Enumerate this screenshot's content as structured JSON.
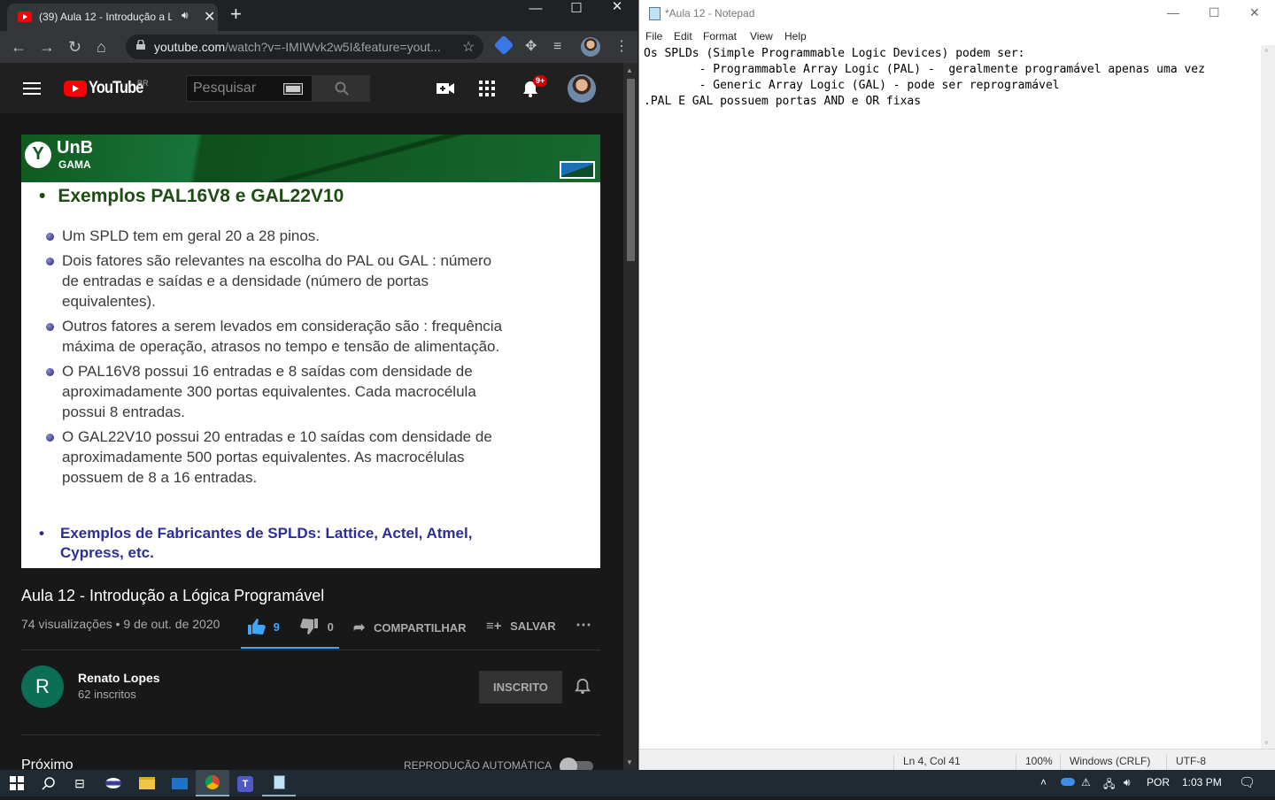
{
  "chrome": {
    "tab_title": "(39) Aula 12 - Introdução a Lógica Programável",
    "url_domain": "youtube.com",
    "url_rest": "/watch?v=-IMIWvk2w5I&feature=yout...",
    "window_min": "—",
    "window_max": "☐",
    "window_close": "✕"
  },
  "youtube": {
    "logo_text": "YouTube",
    "region": "BR",
    "search_placeholder": "Pesquisar",
    "notif_badge": "9+",
    "video_title": "Aula 12 - Introdução a Lógica Programável",
    "views_date": "74 visualizações • 9 de out. de 2020",
    "likes": "9",
    "dislikes": "0",
    "share": "COMPARTILHAR",
    "save": "SALVAR",
    "channel_initial": "R",
    "channel_name": "Renato Lopes",
    "channel_subs": "62 inscritos",
    "subscribed": "INSCRITO",
    "next_label": "Próximo",
    "autoplay_label": "REPRODUÇÃO AUTOMÁTICA"
  },
  "slide": {
    "logo": "UnB",
    "logo_sub": "GAMA",
    "heading": "Exemplos PAL16V8 e GAL22V10",
    "bullets": [
      "Um SPLD tem em geral 20 a 28 pinos.",
      "Dois fatores são relevantes na escolha do PAL ou GAL : número de entradas e saídas e a densidade (número de portas equivalentes).",
      "Outros fatores a serem levados em consideração são : frequência máxima de operação, atrasos no tempo e tensão de alimentação.",
      "O PAL16V8 possui 16 entradas e 8 saídas com densidade de aproximadamente 300 portas equivalentes. Cada macrocélula possui 8 entradas.",
      "O GAL22V10 possui 20 entradas e 10 saídas com densidade de aproximadamente 500 portas equivalentes. As macrocélulas possuem de 8 a 16 entradas."
    ],
    "manufacturers": "Exemplos de Fabricantes de SPLDs: Lattice, Actel, Atmel, Cypress, etc."
  },
  "notepad": {
    "title": "*Aula 12 - Notepad",
    "menu": [
      "File",
      "Edit",
      "Format",
      "View",
      "Help"
    ],
    "content": "Os SPLDs (Simple Programmable Logic Devices) podem ser:\n        - Programmable Array Logic (PAL) -  geralmente programável apenas uma vez\n        - Generic Array Logic (GAL) - pode ser reprogramável\n.PAL E GAL possuem portas AND e OR fixas",
    "status_pos": "Ln 4, Col 41",
    "status_zoom": "100%",
    "status_eol": "Windows (CRLF)",
    "status_enc": "UTF-8"
  },
  "taskbar": {
    "language": "POR",
    "time": "1:03 PM"
  }
}
